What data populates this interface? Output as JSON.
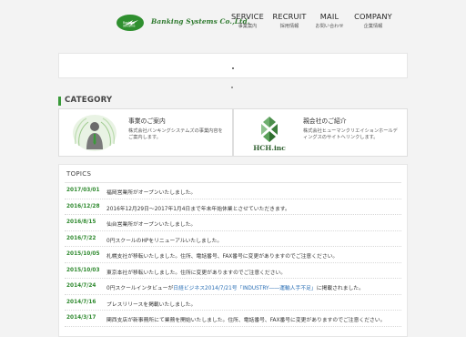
{
  "brand": {
    "name": "Banking Systems Co.,Ltd."
  },
  "nav": [
    {
      "label": "SERVICE",
      "sub": "事業案内"
    },
    {
      "label": "RECRUIT",
      "sub": "採用情報"
    },
    {
      "label": "MAIL",
      "sub": "お問い合わせ"
    },
    {
      "label": "COMPANY",
      "sub": "企業情報"
    }
  ],
  "category": {
    "heading": "CATEGORY",
    "cards": [
      {
        "title": "事業のご案内",
        "desc": "株式会社バンキングシステムズの事業内容をご案内します。",
        "icon": "person-in-shell-icon"
      },
      {
        "title": "親会社のご紹介",
        "desc": "株式会社ヒューマンクリエイションホールディングスのサイトへリンクします。",
        "icon": "hch-logo-icon",
        "logo_text": "HCH.inc"
      }
    ]
  },
  "topics": {
    "heading": "TOPICS",
    "items": [
      {
        "date": "2017/03/01",
        "text": "福岡営業所がオープンいたしました。"
      },
      {
        "date": "2016/12/28",
        "text": "2016年12月29日〜2017年1月4日まで年末年始休業とさせていただきます。"
      },
      {
        "date": "2016/8/15",
        "text": "仙台営業所がオープンいたしました。"
      },
      {
        "date": "2016/7/22",
        "text": "0円スクールのHPをリニューアルいたしました。"
      },
      {
        "date": "2015/10/05",
        "text": "札幌支社が移転いたしました。住所、電話番号、FAX番号に変更がありますのでご注意ください。"
      },
      {
        "date": "2015/10/03",
        "text": "東京本社が移転いたしました。住所に変更がありますのでご注意ください。"
      },
      {
        "date": "2014/7/24",
        "text_before": "0円スクールインタビューが",
        "link": "日経ビジネス2014/7/21号「INDUSTRY――運輸人手不足」",
        "text_after": "に掲載されました。"
      },
      {
        "date": "2014/7/16",
        "text": "プレスリリースを掲載いたしました。"
      },
      {
        "date": "2014/3/17",
        "text": "関西支店が新事務所にて業務を開始いたしました。住所、電話番号、FAX番号に変更がありますのでご注意ください。"
      }
    ]
  },
  "colors": {
    "accent": "#3a9a3a",
    "date": "#2f8a2f",
    "link": "#2a6fb5"
  }
}
